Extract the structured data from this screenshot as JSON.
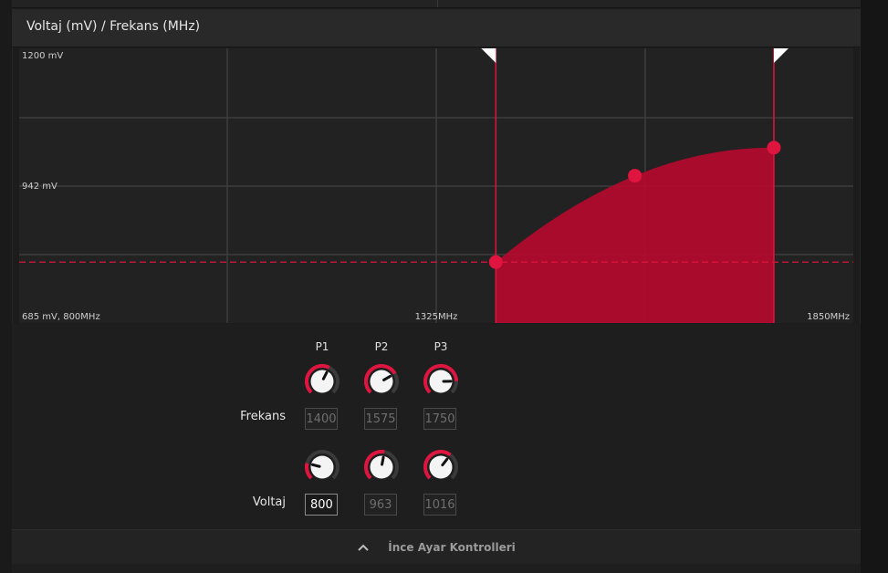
{
  "panel": {
    "title": "Voltaj (mV) / Frekans (MHz)"
  },
  "chart_data": {
    "type": "area",
    "x_axis": {
      "min": 800,
      "max": 1850,
      "tick_labels": [
        "1325MHz",
        "1850MHz"
      ]
    },
    "y_axis": {
      "min": 685,
      "max": 1200,
      "tick_labels": [
        "1200 mV",
        "942 mV"
      ]
    },
    "corner_label": "685 mV, 800MHz",
    "reference_line_mv": 800,
    "series": [
      {
        "x": [
          1400,
          1575,
          1750
        ],
        "y": [
          800,
          963,
          1016
        ]
      }
    ],
    "accent_color": "#b50a2e",
    "point_color": "#e0153f"
  },
  "controls": {
    "columns": [
      "P1",
      "P2",
      "P3"
    ],
    "frekans": {
      "label": "Frekans",
      "values": [
        "1400",
        "1575",
        "1750"
      ],
      "knob_levels": [
        0.6,
        0.72,
        0.83
      ]
    },
    "voltaj": {
      "label": "Voltaj",
      "values": [
        "800",
        "963",
        "1016"
      ],
      "knob_levels": [
        0.22,
        0.54,
        0.64
      ]
    }
  },
  "footer": {
    "label": "İnce Ayar Kontrolleri",
    "icon": "chevron-up-icon"
  }
}
